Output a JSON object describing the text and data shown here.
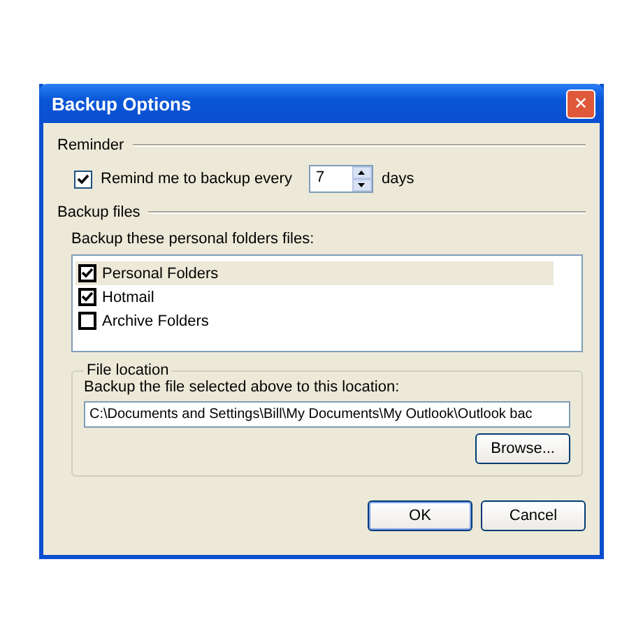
{
  "window": {
    "title": "Backup Options",
    "close": "✕"
  },
  "reminder": {
    "heading": "Reminder",
    "label": "Remind me to backup every",
    "checked": true,
    "value": "7",
    "unit": "days"
  },
  "backup_files": {
    "heading": "Backup files",
    "list_label": "Backup these personal folders files:",
    "items": [
      {
        "label": "Personal Folders",
        "checked": true,
        "selected": true
      },
      {
        "label": "Hotmail",
        "checked": true,
        "selected": false
      },
      {
        "label": "Archive Folders",
        "checked": false,
        "selected": false
      }
    ]
  },
  "file_location": {
    "heading": "File location",
    "label": "Backup the file selected above to this location:",
    "value": "C:\\Documents and Settings\\Bill\\My Documents\\My Outlook\\Outlook bac",
    "browse": "Browse..."
  },
  "buttons": [
    {
      "label": "OK",
      "default": true
    },
    {
      "label": "Cancel",
      "default": false
    }
  ]
}
